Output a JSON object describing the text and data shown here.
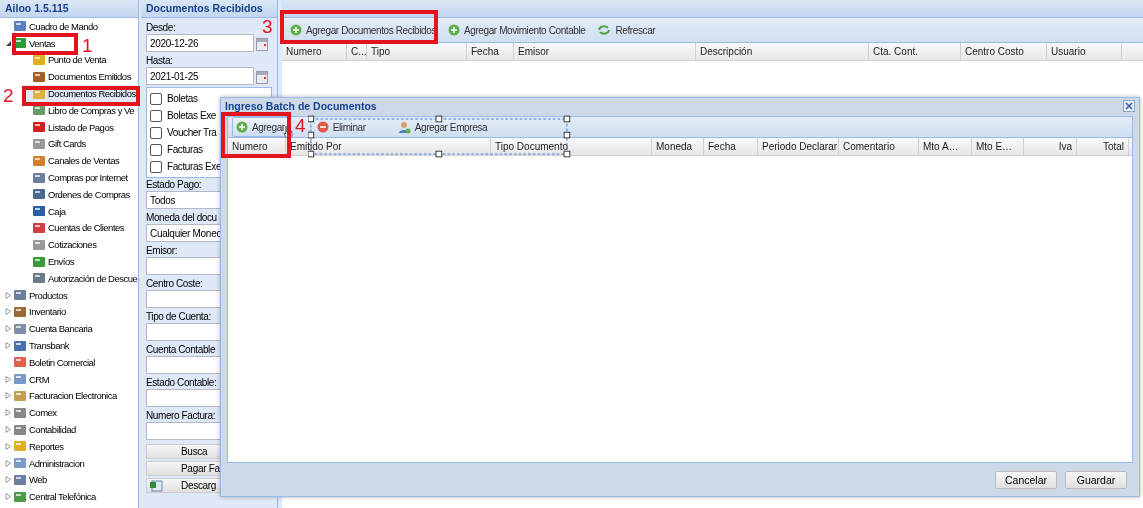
{
  "app": {
    "title": "Ailoo 1.5.115"
  },
  "sidebar": {
    "items": [
      {
        "label": "Cuadro de Mando",
        "selected": false
      },
      {
        "label": "Ventas",
        "selected": false,
        "expanded": true,
        "children": [
          {
            "label": "Punto de Venta",
            "selected": false
          },
          {
            "label": "Documentos Emitidos",
            "selected": false
          },
          {
            "label": "Documentos Recibidos",
            "selected": true
          },
          {
            "label": "Libro de Compras y Ve",
            "selected": false
          },
          {
            "label": "Listado de Pagos",
            "selected": false
          },
          {
            "label": "Gift Cards",
            "selected": false
          },
          {
            "label": "Canales de Ventas",
            "selected": false
          },
          {
            "label": "Compras por Internet",
            "selected": false
          },
          {
            "label": "Ordenes de Compras",
            "selected": false
          },
          {
            "label": "Caja",
            "selected": false
          },
          {
            "label": "Cuentas de Clientes",
            "selected": false
          },
          {
            "label": "Cotizaciones",
            "selected": false
          },
          {
            "label": "Envíos",
            "selected": false
          },
          {
            "label": "Autorización de Descue",
            "selected": false
          }
        ]
      },
      {
        "label": "Productos",
        "selected": false,
        "expanded": false
      },
      {
        "label": "Inventario",
        "selected": false,
        "expanded": false
      },
      {
        "label": "Cuenta Bancaria",
        "selected": false,
        "expanded": false
      },
      {
        "label": "Transbank",
        "selected": false,
        "expanded": false
      },
      {
        "label": "Boletin Comercial",
        "selected": false
      },
      {
        "label": "CRM",
        "selected": false,
        "expanded": false
      },
      {
        "label": "Facturacion Electronica",
        "selected": false,
        "expanded": false
      },
      {
        "label": "Comex",
        "selected": false,
        "expanded": false
      },
      {
        "label": "Contabilidad",
        "selected": false,
        "expanded": false
      },
      {
        "label": "Reportes",
        "selected": false,
        "expanded": false
      },
      {
        "label": "Administracion",
        "selected": false,
        "expanded": false
      },
      {
        "label": "Web",
        "selected": false,
        "expanded": false
      },
      {
        "label": "Central Telefónica",
        "selected": false,
        "expanded": false
      }
    ]
  },
  "filters": {
    "title": "Documentos Recibidos",
    "fields": [
      {
        "kind": "date",
        "label": "Desde:",
        "value": "2020-12-26"
      },
      {
        "kind": "date",
        "label": "Hasta:",
        "value": "2021-01-25"
      },
      {
        "kind": "checklist",
        "options": [
          {
            "label": "Boletas",
            "checked": false
          },
          {
            "label": "Boletas Exe",
            "checked": false
          },
          {
            "label": "Voucher Tra",
            "checked": false
          },
          {
            "label": "Facturas",
            "checked": false
          },
          {
            "label": "Facturas Exe",
            "checked": false
          }
        ]
      },
      {
        "kind": "select",
        "label": "Estado Pago:",
        "value": "Todos"
      },
      {
        "kind": "select",
        "label": "Moneda del docu",
        "value": "Cualquier Monec"
      },
      {
        "kind": "text",
        "label": "Emisor:"
      },
      {
        "kind": "text",
        "label": "Centro Coste:"
      },
      {
        "kind": "text",
        "label": "Tipo de Cuenta:"
      },
      {
        "kind": "text",
        "label": "Cuenta Contable"
      },
      {
        "kind": "text",
        "label": "Estado Contable:"
      },
      {
        "kind": "text",
        "label": "Numero Factura:"
      }
    ],
    "buttons": [
      {
        "label": "Busca",
        "kind": "plain"
      },
      {
        "label": "Pagar Fa",
        "kind": "plain"
      },
      {
        "label": "Descarg",
        "kind": "excel"
      }
    ]
  },
  "main": {
    "toolbar": [
      {
        "label": "Agregar Documentos Recibidos",
        "kind": "add"
      },
      {
        "label": "Agregar Movimiento Contable",
        "kind": "add"
      },
      {
        "label": "Refrescar",
        "kind": "refresh"
      }
    ],
    "columns": [
      "Numero",
      "C...",
      "Tipo",
      "Fecha",
      "Emisor",
      "Descripción",
      "Cta. Cont.",
      "Centro Costo",
      "Usuario"
    ]
  },
  "dialog": {
    "title": "Ingreso Batch de Documentos",
    "toolbar": [
      {
        "label": "Agregar",
        "kind": "add",
        "hovered": true
      },
      {
        "label": "Eliminar",
        "kind": "remove",
        "hovered": false
      },
      {
        "label": "Agregar Empresa",
        "kind": "person",
        "hovered": false
      }
    ],
    "columns": [
      "Numero",
      "Emitido Por",
      "Tipo Documento",
      "Moneda",
      "Fecha",
      "Periodo Declarar",
      "Comentario",
      "Mto A…",
      "Mto E…",
      "Iva",
      "Total"
    ],
    "buttons": [
      "Cancelar",
      "Guardar"
    ]
  },
  "annotations": [
    {
      "label": "1"
    },
    {
      "label": "2"
    },
    {
      "label": "3"
    },
    {
      "label": "4"
    }
  ]
}
